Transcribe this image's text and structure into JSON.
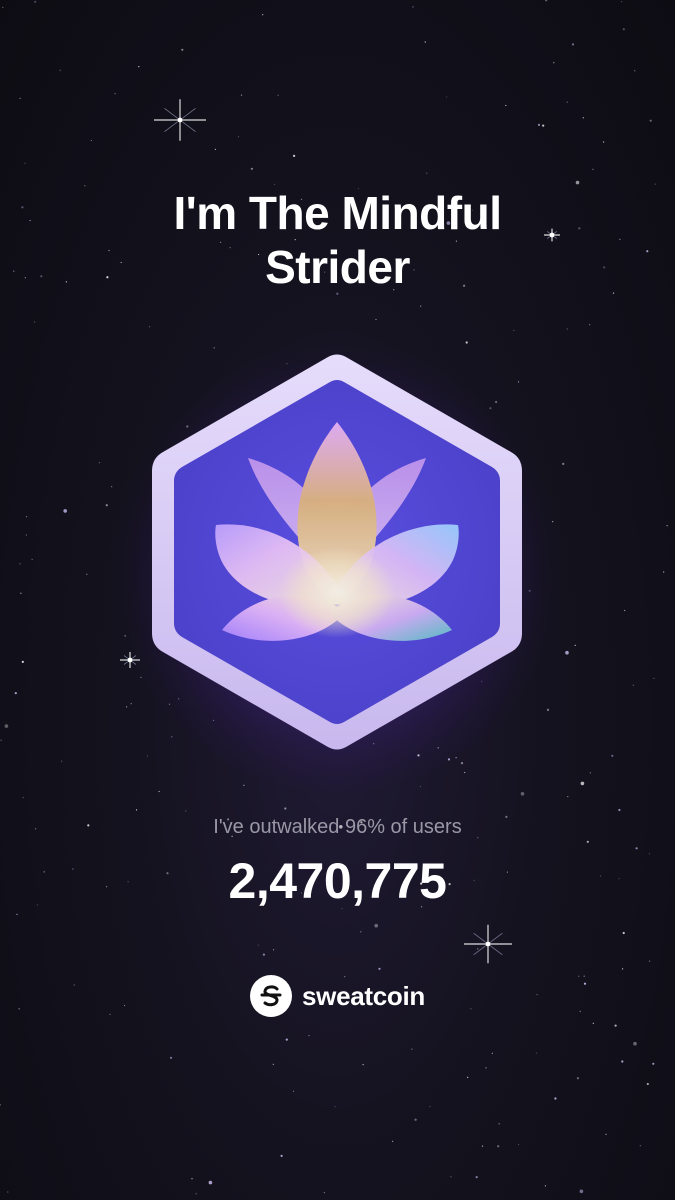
{
  "card": {
    "title_line1": "I'm The Mindful",
    "title_line2": "Strider"
  },
  "badge": {
    "icon": "lotus-icon",
    "frame_color": "#d9cdf2",
    "inner_color": "#5246d1"
  },
  "stats": {
    "caption": "I've outwalked 96% of users",
    "value": "2,470,775"
  },
  "brand": {
    "icon": "sweatcoin-logo-icon",
    "name": "sweatcoin"
  },
  "colors": {
    "background": "#14121e",
    "text_primary": "#ffffff",
    "text_secondary": "#9a98a6"
  }
}
